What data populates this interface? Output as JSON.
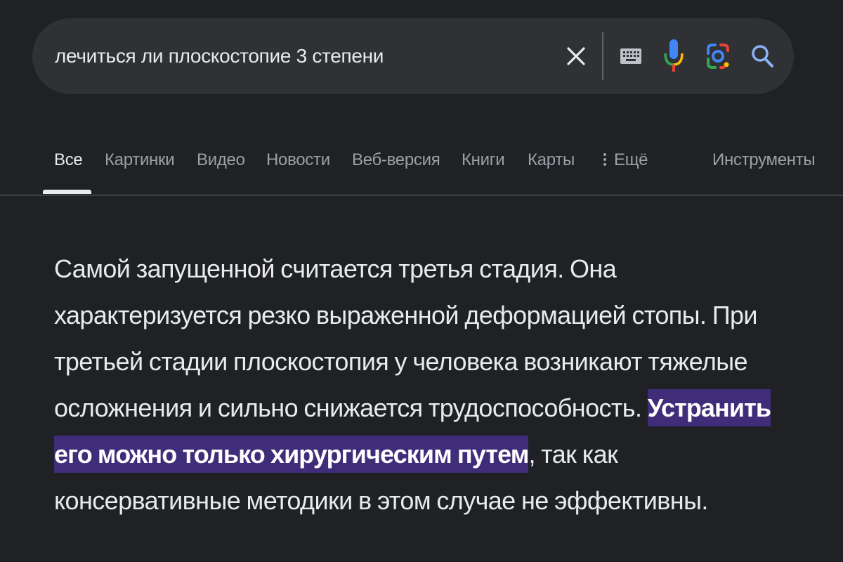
{
  "search": {
    "query": "лечиться ли плоскостопие 3 степени",
    "clear_icon": "close-icon",
    "keyboard_icon": "keyboard-icon",
    "voice_icon": "microphone-icon",
    "lens_icon": "google-lens-icon",
    "search_icon": "search-icon"
  },
  "tabs": {
    "items": [
      {
        "label": "Все",
        "active": true
      },
      {
        "label": "Картинки"
      },
      {
        "label": "Видео"
      },
      {
        "label": "Новости"
      },
      {
        "label": "Веб-версия"
      },
      {
        "label": "Книги"
      },
      {
        "label": "Карты"
      },
      {
        "label": "Ещё",
        "icon": "more-vert-icon"
      }
    ],
    "tools_label": "Инструменты"
  },
  "snippet": {
    "text_before": "Самой запущенной считается третья стадия. Она характеризуется резко выраженной деформацией стопы. При третьей стадии плоскостопия у человека возникают тяжелые осложнения и сильно снижается трудоспособность. ",
    "highlighted": "Устранить его можно только хирургическим путем",
    "text_after": ", так как консервативные методики в этом случае не эффективны."
  },
  "colors": {
    "background": "#202124",
    "search_bar": "#303134",
    "highlight": "#3f2d7a",
    "text_primary": "#e8eaed",
    "text_secondary": "#9aa0a6"
  }
}
